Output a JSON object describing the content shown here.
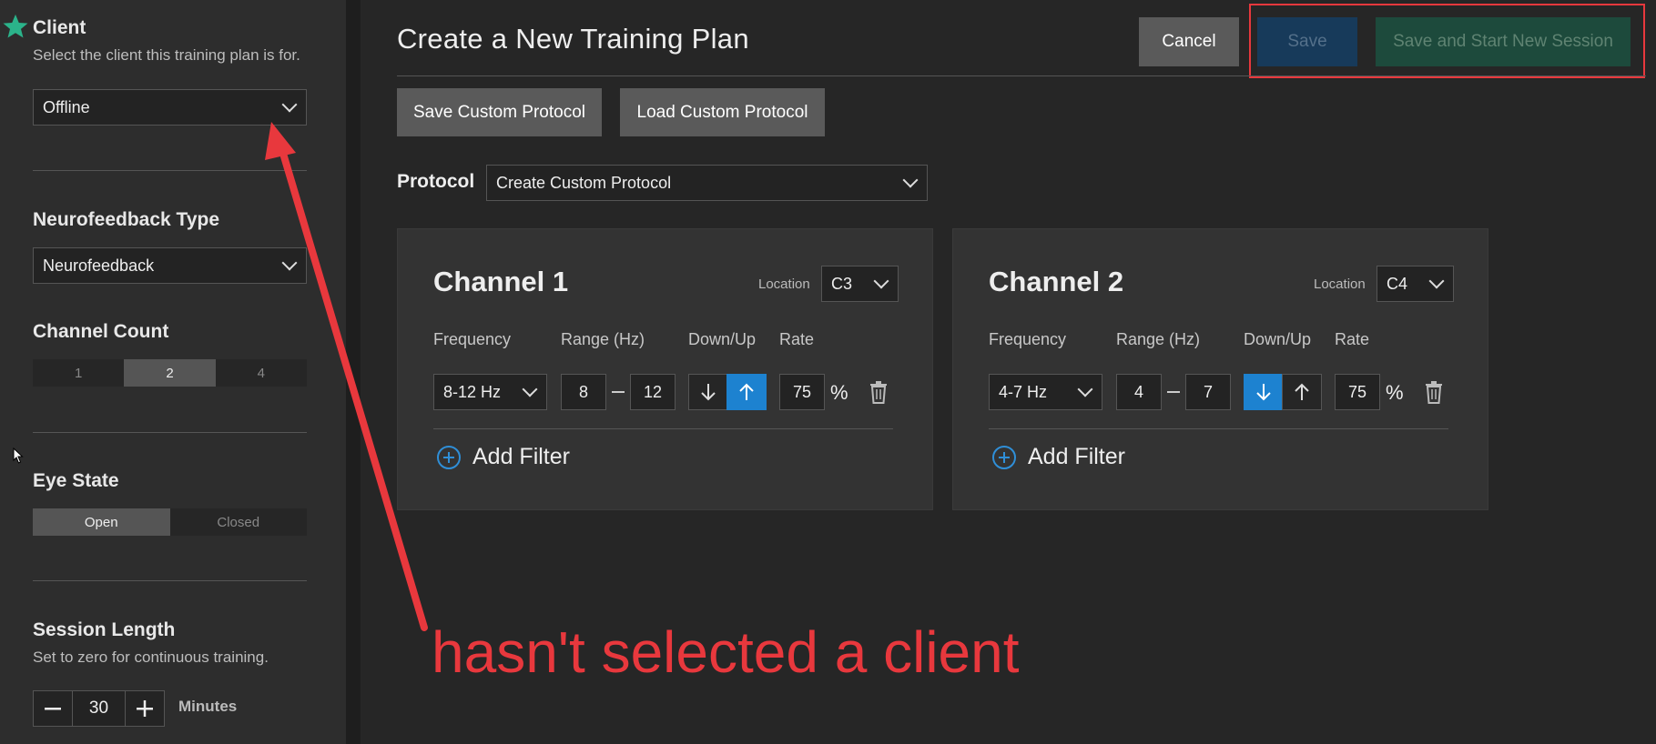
{
  "sidebar": {
    "client": {
      "title": "Client",
      "description": "Select the client this training plan is for.",
      "selected": "Offline"
    },
    "neurofeedback_type": {
      "title": "Neurofeedback Type",
      "selected": "Neurofeedback"
    },
    "channel_count": {
      "title": "Channel Count",
      "options": [
        "1",
        "2",
        "4"
      ],
      "selected": "2"
    },
    "eye_state": {
      "title": "Eye State",
      "options": [
        "Open",
        "Closed"
      ],
      "selected": "Open"
    },
    "session_length": {
      "title": "Session Length",
      "description": "Set to zero for continuous training.",
      "value": "30",
      "unit": "Minutes"
    }
  },
  "header": {
    "title": "Create a New Training Plan",
    "cancel_label": "Cancel",
    "save_label": "Save",
    "save_start_label": "Save and Start New Session"
  },
  "toolbar": {
    "save_custom_label": "Save Custom Protocol",
    "load_custom_label": "Load Custom Protocol"
  },
  "protocol": {
    "label": "Protocol",
    "selected": "Create Custom Protocol"
  },
  "channels": [
    {
      "title": "Channel 1",
      "location_label": "Location",
      "location": "C3",
      "frequency_label": "Frequency",
      "range_label": "Range (Hz)",
      "downup_label": "Down/Up",
      "rate_label": "Rate",
      "frequency": "8-12 Hz",
      "range_low": "8",
      "range_high": "12",
      "direction": "up",
      "rate": "75",
      "rate_unit": "%",
      "add_filter_label": "Add Filter"
    },
    {
      "title": "Channel 2",
      "location_label": "Location",
      "location": "C4",
      "frequency_label": "Frequency",
      "range_label": "Range (Hz)",
      "downup_label": "Down/Up",
      "rate_label": "Rate",
      "frequency": "4-7 Hz",
      "range_low": "4",
      "range_high": "7",
      "direction": "down",
      "rate": "75",
      "rate_unit": "%",
      "add_filter_label": "Add Filter"
    }
  ],
  "annotation": {
    "text": "hasn't selected a client",
    "color": "#e8383d"
  },
  "colors": {
    "accent_blue": "#1d82d0",
    "star_green": "#2bb38a"
  }
}
